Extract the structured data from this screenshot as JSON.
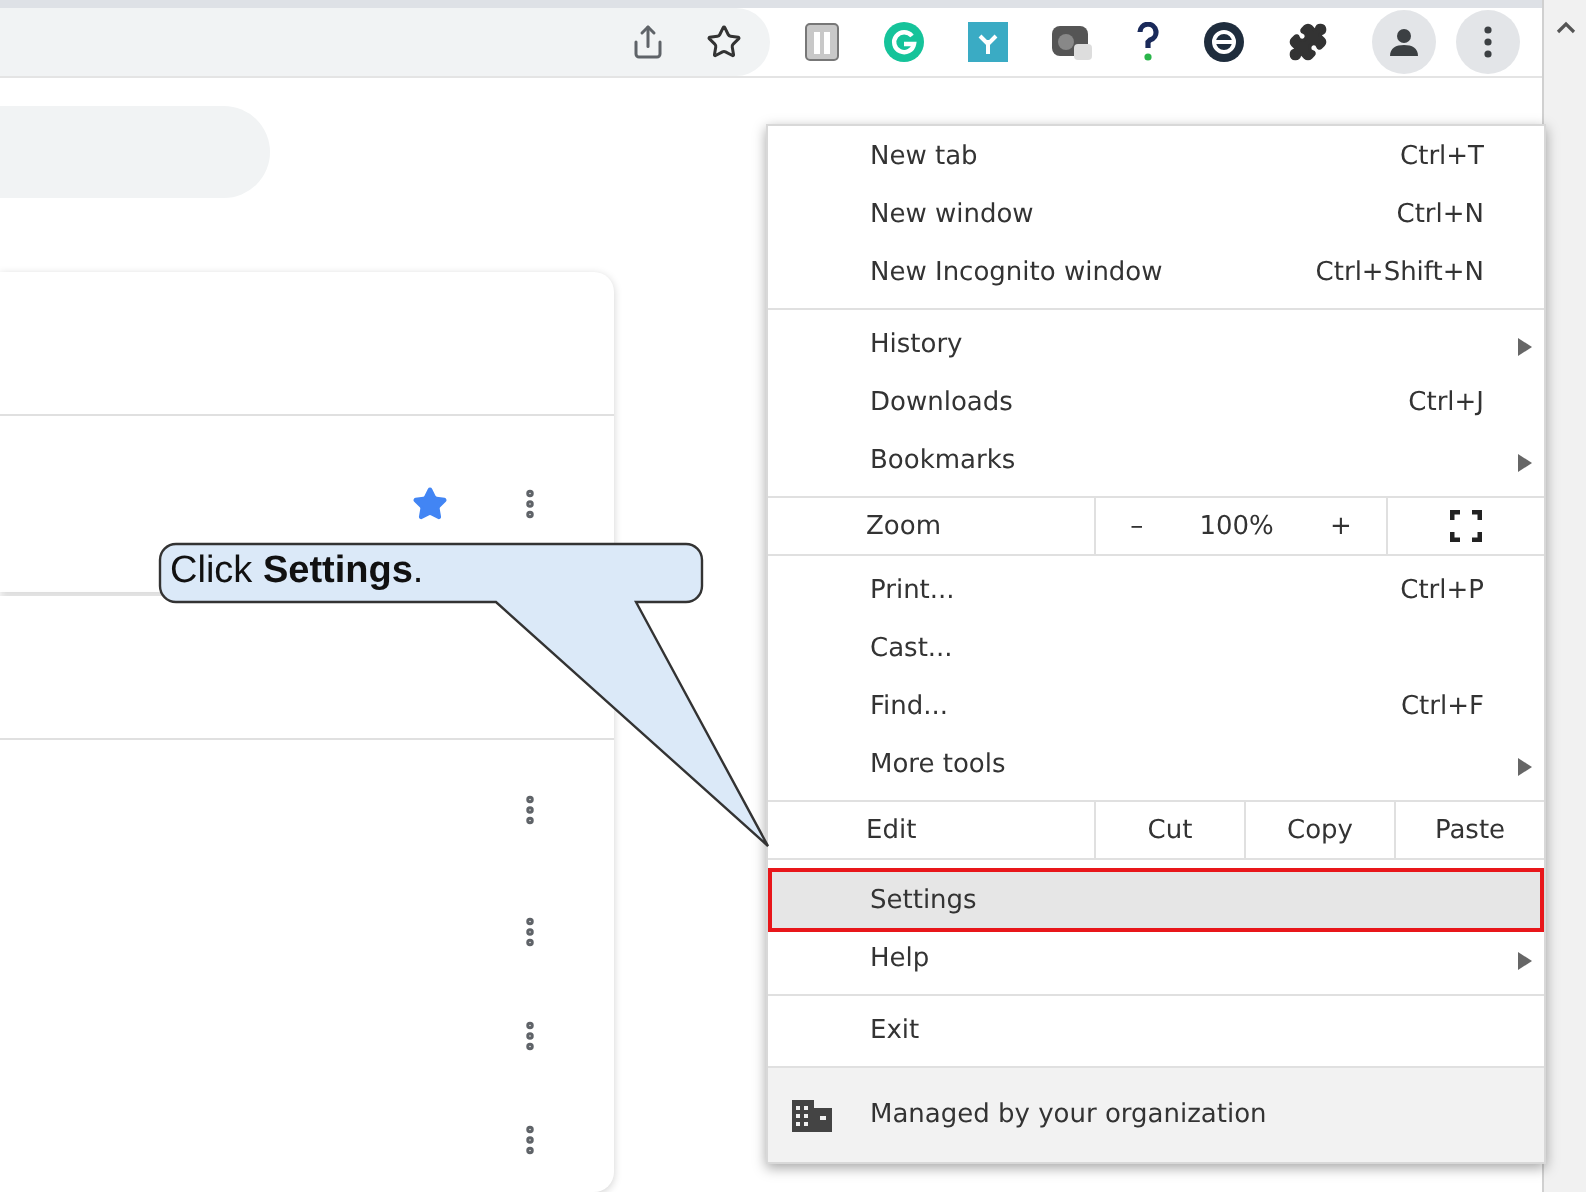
{
  "callout": {
    "text": "Click **Settings**."
  },
  "menu": {
    "sections": [
      {
        "items": [
          {
            "kind": "item",
            "label": "New tab",
            "shortcut": "Ctrl+T",
            "submenu": false,
            "highlighted": false
          },
          {
            "kind": "item",
            "label": "New window",
            "shortcut": "Ctrl+N",
            "submenu": false,
            "highlighted": false
          },
          {
            "kind": "item",
            "label": "New Incognito window",
            "shortcut": "Ctrl+Shift+N",
            "submenu": false,
            "highlighted": false
          }
        ]
      },
      {
        "items": [
          {
            "kind": "item",
            "label": "History",
            "submenu": true,
            "highlighted": false
          },
          {
            "kind": "item",
            "label": "Downloads",
            "shortcut": "Ctrl+J",
            "submenu": false,
            "highlighted": false
          },
          {
            "kind": "item",
            "label": "Bookmarks",
            "submenu": true,
            "highlighted": false
          }
        ]
      },
      {
        "items": [
          {
            "kind": "zoom",
            "label": "Zoom",
            "minus": "–",
            "value": "100%",
            "plus": "+"
          }
        ]
      },
      {
        "items": [
          {
            "kind": "item",
            "label": "Print...",
            "shortcut": "Ctrl+P",
            "submenu": false,
            "highlighted": false
          },
          {
            "kind": "item",
            "label": "Cast...",
            "submenu": false,
            "highlighted": false
          },
          {
            "kind": "item",
            "label": "Find...",
            "shortcut": "Ctrl+F",
            "submenu": false,
            "highlighted": false
          },
          {
            "kind": "item",
            "label": "More tools",
            "submenu": true,
            "highlighted": false
          }
        ]
      },
      {
        "items": [
          {
            "kind": "edit",
            "label": "Edit",
            "actions": [
              "Cut",
              "Copy",
              "Paste"
            ]
          }
        ]
      },
      {
        "items": [
          {
            "kind": "item",
            "label": "Settings",
            "submenu": false,
            "highlighted": true
          },
          {
            "kind": "item",
            "label": "Help",
            "submenu": true,
            "highlighted": false
          }
        ]
      },
      {
        "items": [
          {
            "kind": "item",
            "label": "Exit",
            "submenu": false,
            "highlighted": false
          }
        ]
      },
      {
        "items": [
          {
            "kind": "managed",
            "label": "Managed by your organization"
          }
        ]
      }
    ]
  }
}
